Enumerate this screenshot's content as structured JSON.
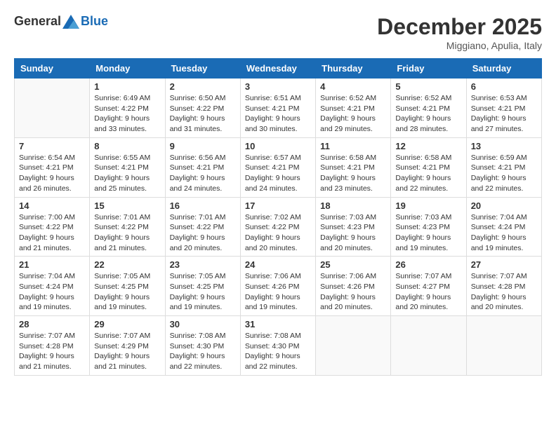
{
  "header": {
    "logo_general": "General",
    "logo_blue": "Blue",
    "month_title": "December 2025",
    "location": "Miggiano, Apulia, Italy"
  },
  "weekdays": [
    "Sunday",
    "Monday",
    "Tuesday",
    "Wednesday",
    "Thursday",
    "Friday",
    "Saturday"
  ],
  "weeks": [
    [
      {
        "day": "",
        "info": ""
      },
      {
        "day": "1",
        "info": "Sunrise: 6:49 AM\nSunset: 4:22 PM\nDaylight: 9 hours\nand 33 minutes."
      },
      {
        "day": "2",
        "info": "Sunrise: 6:50 AM\nSunset: 4:22 PM\nDaylight: 9 hours\nand 31 minutes."
      },
      {
        "day": "3",
        "info": "Sunrise: 6:51 AM\nSunset: 4:21 PM\nDaylight: 9 hours\nand 30 minutes."
      },
      {
        "day": "4",
        "info": "Sunrise: 6:52 AM\nSunset: 4:21 PM\nDaylight: 9 hours\nand 29 minutes."
      },
      {
        "day": "5",
        "info": "Sunrise: 6:52 AM\nSunset: 4:21 PM\nDaylight: 9 hours\nand 28 minutes."
      },
      {
        "day": "6",
        "info": "Sunrise: 6:53 AM\nSunset: 4:21 PM\nDaylight: 9 hours\nand 27 minutes."
      }
    ],
    [
      {
        "day": "7",
        "info": "Sunrise: 6:54 AM\nSunset: 4:21 PM\nDaylight: 9 hours\nand 26 minutes."
      },
      {
        "day": "8",
        "info": "Sunrise: 6:55 AM\nSunset: 4:21 PM\nDaylight: 9 hours\nand 25 minutes."
      },
      {
        "day": "9",
        "info": "Sunrise: 6:56 AM\nSunset: 4:21 PM\nDaylight: 9 hours\nand 24 minutes."
      },
      {
        "day": "10",
        "info": "Sunrise: 6:57 AM\nSunset: 4:21 PM\nDaylight: 9 hours\nand 24 minutes."
      },
      {
        "day": "11",
        "info": "Sunrise: 6:58 AM\nSunset: 4:21 PM\nDaylight: 9 hours\nand 23 minutes."
      },
      {
        "day": "12",
        "info": "Sunrise: 6:58 AM\nSunset: 4:21 PM\nDaylight: 9 hours\nand 22 minutes."
      },
      {
        "day": "13",
        "info": "Sunrise: 6:59 AM\nSunset: 4:21 PM\nDaylight: 9 hours\nand 22 minutes."
      }
    ],
    [
      {
        "day": "14",
        "info": "Sunrise: 7:00 AM\nSunset: 4:22 PM\nDaylight: 9 hours\nand 21 minutes."
      },
      {
        "day": "15",
        "info": "Sunrise: 7:01 AM\nSunset: 4:22 PM\nDaylight: 9 hours\nand 21 minutes."
      },
      {
        "day": "16",
        "info": "Sunrise: 7:01 AM\nSunset: 4:22 PM\nDaylight: 9 hours\nand 20 minutes."
      },
      {
        "day": "17",
        "info": "Sunrise: 7:02 AM\nSunset: 4:22 PM\nDaylight: 9 hours\nand 20 minutes."
      },
      {
        "day": "18",
        "info": "Sunrise: 7:03 AM\nSunset: 4:23 PM\nDaylight: 9 hours\nand 20 minutes."
      },
      {
        "day": "19",
        "info": "Sunrise: 7:03 AM\nSunset: 4:23 PM\nDaylight: 9 hours\nand 19 minutes."
      },
      {
        "day": "20",
        "info": "Sunrise: 7:04 AM\nSunset: 4:24 PM\nDaylight: 9 hours\nand 19 minutes."
      }
    ],
    [
      {
        "day": "21",
        "info": "Sunrise: 7:04 AM\nSunset: 4:24 PM\nDaylight: 9 hours\nand 19 minutes."
      },
      {
        "day": "22",
        "info": "Sunrise: 7:05 AM\nSunset: 4:25 PM\nDaylight: 9 hours\nand 19 minutes."
      },
      {
        "day": "23",
        "info": "Sunrise: 7:05 AM\nSunset: 4:25 PM\nDaylight: 9 hours\nand 19 minutes."
      },
      {
        "day": "24",
        "info": "Sunrise: 7:06 AM\nSunset: 4:26 PM\nDaylight: 9 hours\nand 19 minutes."
      },
      {
        "day": "25",
        "info": "Sunrise: 7:06 AM\nSunset: 4:26 PM\nDaylight: 9 hours\nand 20 minutes."
      },
      {
        "day": "26",
        "info": "Sunrise: 7:07 AM\nSunset: 4:27 PM\nDaylight: 9 hours\nand 20 minutes."
      },
      {
        "day": "27",
        "info": "Sunrise: 7:07 AM\nSunset: 4:28 PM\nDaylight: 9 hours\nand 20 minutes."
      }
    ],
    [
      {
        "day": "28",
        "info": "Sunrise: 7:07 AM\nSunset: 4:28 PM\nDaylight: 9 hours\nand 21 minutes."
      },
      {
        "day": "29",
        "info": "Sunrise: 7:07 AM\nSunset: 4:29 PM\nDaylight: 9 hours\nand 21 minutes."
      },
      {
        "day": "30",
        "info": "Sunrise: 7:08 AM\nSunset: 4:30 PM\nDaylight: 9 hours\nand 22 minutes."
      },
      {
        "day": "31",
        "info": "Sunrise: 7:08 AM\nSunset: 4:30 PM\nDaylight: 9 hours\nand 22 minutes."
      },
      {
        "day": "",
        "info": ""
      },
      {
        "day": "",
        "info": ""
      },
      {
        "day": "",
        "info": ""
      }
    ]
  ]
}
